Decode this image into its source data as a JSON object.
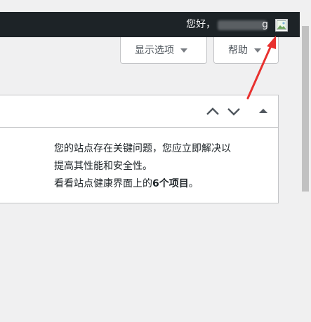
{
  "adminbar": {
    "greeting": "您好，",
    "username_tail": "g",
    "avatar_icon": "broken-image-icon"
  },
  "screen_meta": {
    "options_label": "显示选项",
    "help_label": "帮助"
  },
  "notice": {
    "line1": "您的站点存在关键问题，您应立即解决以",
    "line2": "提高其性能和安全性。",
    "line3_prefix": "看看站点健康界面上的",
    "line3_strong": "6个项目",
    "line3_suffix": "。"
  },
  "colors": {
    "adminbar_bg": "#1d2327",
    "page_bg": "#f0f0f1",
    "annotation_arrow": "#e8312f"
  }
}
